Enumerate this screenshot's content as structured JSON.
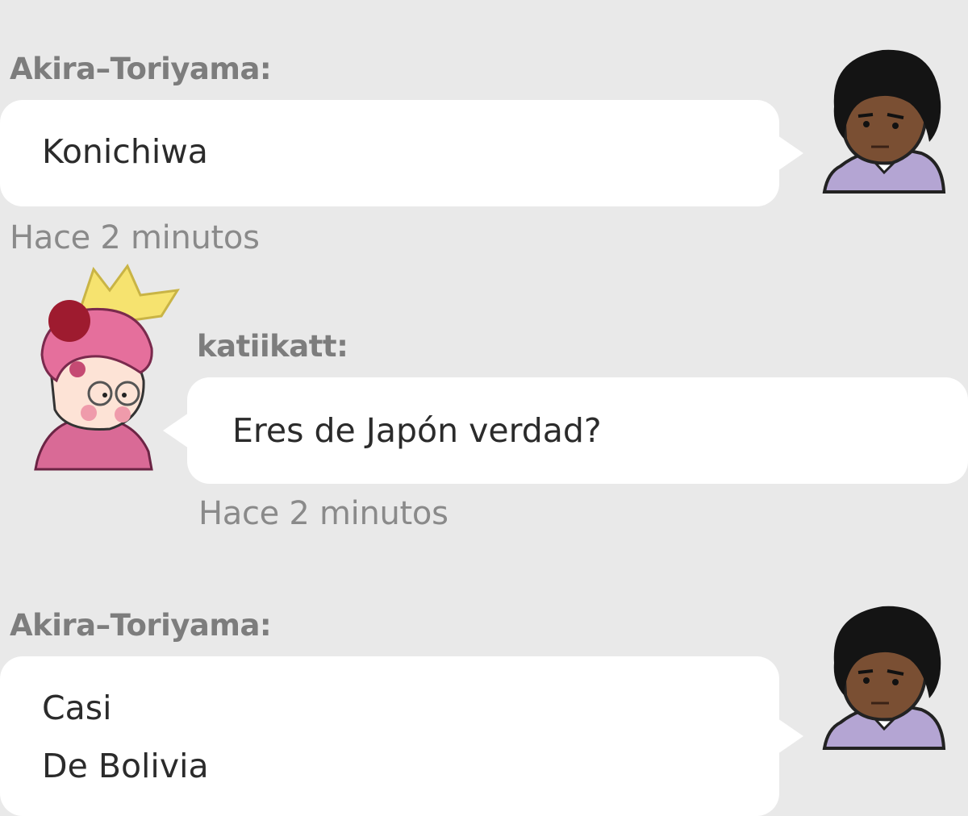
{
  "messages": [
    {
      "author": "Akira–Toriyama:",
      "lines": [
        "Konichiwa"
      ],
      "time": "Hace 2 minutos",
      "avatar": "male-avatar-icon"
    },
    {
      "author": "katiikatt:",
      "lines": [
        "Eres de Japón verdad?"
      ],
      "time": "Hace 2 minutos",
      "avatar": "female-avatar-icon"
    },
    {
      "author": "Akira–Toriyama:",
      "lines": [
        "Casi",
        "De Bolivia"
      ],
      "time": "",
      "avatar": "male-avatar-icon"
    }
  ],
  "colors": {
    "background": "#e9e9e9",
    "bubble": "#ffffff",
    "username": "#7d7d7d",
    "timestamp": "#8a8a8a",
    "text": "#2b2b2b"
  }
}
